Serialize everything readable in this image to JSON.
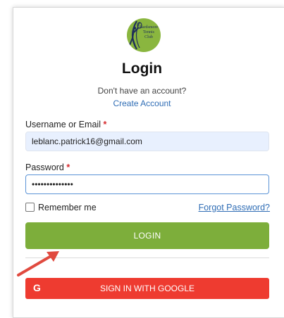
{
  "logo": {
    "lines": [
      "Bardsmore",
      "Tennis",
      "Club"
    ]
  },
  "header": {
    "title": "Login",
    "no_account": "Don't have an account?",
    "create_account": "Create Account"
  },
  "form": {
    "username_label": "Username or Email",
    "username_value": "leblanc.patrick16@gmail.com",
    "password_label": "Password",
    "password_value": "••••••••••••••",
    "required_mark": "*",
    "remember_label": "Remember me",
    "forgot_label": "Forgot Password?",
    "login_label": "LOGIN",
    "google_label": "SIGN IN WITH GOOGLE",
    "google_icon": "G"
  },
  "colors": {
    "login_button": "#7dae3b",
    "google_button": "#ee3b30",
    "link": "#2f6db5",
    "annotation_arrow": "#e04a3f"
  }
}
